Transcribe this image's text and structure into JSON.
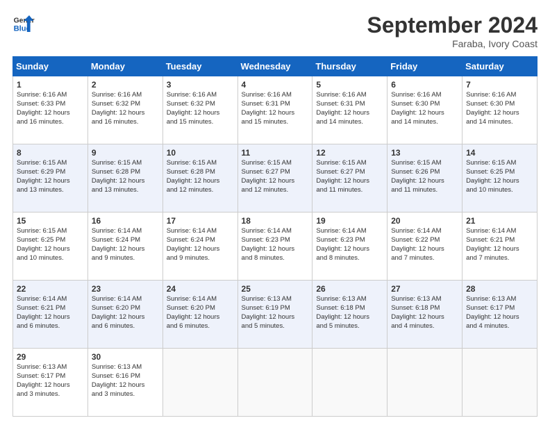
{
  "header": {
    "logo_line1": "General",
    "logo_line2": "Blue",
    "month_year": "September 2024",
    "location": "Faraba, Ivory Coast"
  },
  "days_of_week": [
    "Sunday",
    "Monday",
    "Tuesday",
    "Wednesday",
    "Thursday",
    "Friday",
    "Saturday"
  ],
  "weeks": [
    [
      {
        "day": "1",
        "lines": [
          "Sunrise: 6:16 AM",
          "Sunset: 6:33 PM",
          "Daylight: 12 hours",
          "and 16 minutes."
        ]
      },
      {
        "day": "2",
        "lines": [
          "Sunrise: 6:16 AM",
          "Sunset: 6:32 PM",
          "Daylight: 12 hours",
          "and 16 minutes."
        ]
      },
      {
        "day": "3",
        "lines": [
          "Sunrise: 6:16 AM",
          "Sunset: 6:32 PM",
          "Daylight: 12 hours",
          "and 15 minutes."
        ]
      },
      {
        "day": "4",
        "lines": [
          "Sunrise: 6:16 AM",
          "Sunset: 6:31 PM",
          "Daylight: 12 hours",
          "and 15 minutes."
        ]
      },
      {
        "day": "5",
        "lines": [
          "Sunrise: 6:16 AM",
          "Sunset: 6:31 PM",
          "Daylight: 12 hours",
          "and 14 minutes."
        ]
      },
      {
        "day": "6",
        "lines": [
          "Sunrise: 6:16 AM",
          "Sunset: 6:30 PM",
          "Daylight: 12 hours",
          "and 14 minutes."
        ]
      },
      {
        "day": "7",
        "lines": [
          "Sunrise: 6:16 AM",
          "Sunset: 6:30 PM",
          "Daylight: 12 hours",
          "and 14 minutes."
        ]
      }
    ],
    [
      {
        "day": "8",
        "lines": [
          "Sunrise: 6:15 AM",
          "Sunset: 6:29 PM",
          "Daylight: 12 hours",
          "and 13 minutes."
        ]
      },
      {
        "day": "9",
        "lines": [
          "Sunrise: 6:15 AM",
          "Sunset: 6:28 PM",
          "Daylight: 12 hours",
          "and 13 minutes."
        ]
      },
      {
        "day": "10",
        "lines": [
          "Sunrise: 6:15 AM",
          "Sunset: 6:28 PM",
          "Daylight: 12 hours",
          "and 12 minutes."
        ]
      },
      {
        "day": "11",
        "lines": [
          "Sunrise: 6:15 AM",
          "Sunset: 6:27 PM",
          "Daylight: 12 hours",
          "and 12 minutes."
        ]
      },
      {
        "day": "12",
        "lines": [
          "Sunrise: 6:15 AM",
          "Sunset: 6:27 PM",
          "Daylight: 12 hours",
          "and 11 minutes."
        ]
      },
      {
        "day": "13",
        "lines": [
          "Sunrise: 6:15 AM",
          "Sunset: 6:26 PM",
          "Daylight: 12 hours",
          "and 11 minutes."
        ]
      },
      {
        "day": "14",
        "lines": [
          "Sunrise: 6:15 AM",
          "Sunset: 6:25 PM",
          "Daylight: 12 hours",
          "and 10 minutes."
        ]
      }
    ],
    [
      {
        "day": "15",
        "lines": [
          "Sunrise: 6:15 AM",
          "Sunset: 6:25 PM",
          "Daylight: 12 hours",
          "and 10 minutes."
        ]
      },
      {
        "day": "16",
        "lines": [
          "Sunrise: 6:14 AM",
          "Sunset: 6:24 PM",
          "Daylight: 12 hours",
          "and 9 minutes."
        ]
      },
      {
        "day": "17",
        "lines": [
          "Sunrise: 6:14 AM",
          "Sunset: 6:24 PM",
          "Daylight: 12 hours",
          "and 9 minutes."
        ]
      },
      {
        "day": "18",
        "lines": [
          "Sunrise: 6:14 AM",
          "Sunset: 6:23 PM",
          "Daylight: 12 hours",
          "and 8 minutes."
        ]
      },
      {
        "day": "19",
        "lines": [
          "Sunrise: 6:14 AM",
          "Sunset: 6:23 PM",
          "Daylight: 12 hours",
          "and 8 minutes."
        ]
      },
      {
        "day": "20",
        "lines": [
          "Sunrise: 6:14 AM",
          "Sunset: 6:22 PM",
          "Daylight: 12 hours",
          "and 7 minutes."
        ]
      },
      {
        "day": "21",
        "lines": [
          "Sunrise: 6:14 AM",
          "Sunset: 6:21 PM",
          "Daylight: 12 hours",
          "and 7 minutes."
        ]
      }
    ],
    [
      {
        "day": "22",
        "lines": [
          "Sunrise: 6:14 AM",
          "Sunset: 6:21 PM",
          "Daylight: 12 hours",
          "and 6 minutes."
        ]
      },
      {
        "day": "23",
        "lines": [
          "Sunrise: 6:14 AM",
          "Sunset: 6:20 PM",
          "Daylight: 12 hours",
          "and 6 minutes."
        ]
      },
      {
        "day": "24",
        "lines": [
          "Sunrise: 6:14 AM",
          "Sunset: 6:20 PM",
          "Daylight: 12 hours",
          "and 6 minutes."
        ]
      },
      {
        "day": "25",
        "lines": [
          "Sunrise: 6:13 AM",
          "Sunset: 6:19 PM",
          "Daylight: 12 hours",
          "and 5 minutes."
        ]
      },
      {
        "day": "26",
        "lines": [
          "Sunrise: 6:13 AM",
          "Sunset: 6:18 PM",
          "Daylight: 12 hours",
          "and 5 minutes."
        ]
      },
      {
        "day": "27",
        "lines": [
          "Sunrise: 6:13 AM",
          "Sunset: 6:18 PM",
          "Daylight: 12 hours",
          "and 4 minutes."
        ]
      },
      {
        "day": "28",
        "lines": [
          "Sunrise: 6:13 AM",
          "Sunset: 6:17 PM",
          "Daylight: 12 hours",
          "and 4 minutes."
        ]
      }
    ],
    [
      {
        "day": "29",
        "lines": [
          "Sunrise: 6:13 AM",
          "Sunset: 6:17 PM",
          "Daylight: 12 hours",
          "and 3 minutes."
        ]
      },
      {
        "day": "30",
        "lines": [
          "Sunrise: 6:13 AM",
          "Sunset: 6:16 PM",
          "Daylight: 12 hours",
          "and 3 minutes."
        ]
      },
      {
        "day": "",
        "lines": []
      },
      {
        "day": "",
        "lines": []
      },
      {
        "day": "",
        "lines": []
      },
      {
        "day": "",
        "lines": []
      },
      {
        "day": "",
        "lines": []
      }
    ]
  ]
}
